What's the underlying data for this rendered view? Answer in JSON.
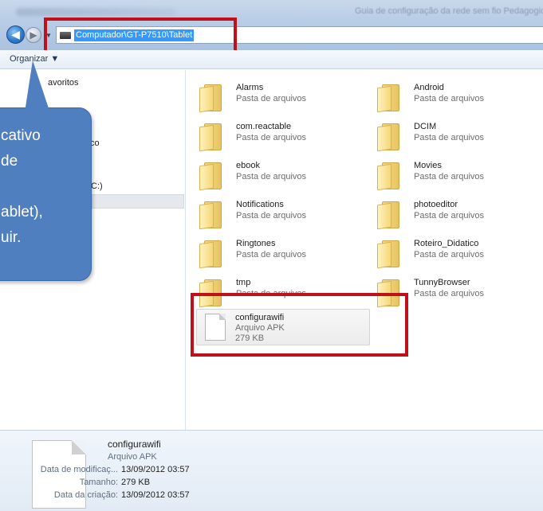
{
  "window": {
    "title": "Guia de configuração da rede sem fio Pedagogica SME"
  },
  "address": {
    "path": "Computador\\GT-P7510\\Tablet"
  },
  "toolbar": {
    "organize_label": "Organizar ▼"
  },
  "nav": {
    "items": [
      {
        "label": "avoritos"
      },
      {
        "label": "co"
      },
      {
        "label": "C:)"
      }
    ]
  },
  "callout": {
    "lines": [
      "cativo",
      "de",
      "",
      "ablet),",
      "uir."
    ]
  },
  "folders": [
    {
      "name": "Alarms",
      "type": "Pasta de arquivos"
    },
    {
      "name": "Android",
      "type": "Pasta de arquivos"
    },
    {
      "name": "com.reactable",
      "type": "Pasta de arquivos"
    },
    {
      "name": "DCIM",
      "type": "Pasta de arquivos"
    },
    {
      "name": "ebook",
      "type": "Pasta de arquivos"
    },
    {
      "name": "Movies",
      "type": "Pasta de arquivos"
    },
    {
      "name": "Notifications",
      "type": "Pasta de arquivos"
    },
    {
      "name": "photoeditor",
      "type": "Pasta de arquivos"
    },
    {
      "name": "Ringtones",
      "type": "Pasta de arquivos"
    },
    {
      "name": "Roteiro_Didatico",
      "type": "Pasta de arquivos"
    },
    {
      "name": "tmp",
      "type": "Pasta de arquivos"
    },
    {
      "name": "TunnyBrowser",
      "type": "Pasta de arquivos"
    }
  ],
  "apk_file": {
    "name": "configurawifi",
    "type": "Arquivo APK",
    "size": "279 KB"
  },
  "details": {
    "name": "configurawifi",
    "type": "Arquivo APK",
    "fields": [
      {
        "label": "Data de modificaç...",
        "value": "13/09/2012 03:57"
      },
      {
        "label": "Tamanho:",
        "value": "279 KB"
      },
      {
        "label": "Data da criação:",
        "value": "13/09/2012 03:57"
      }
    ]
  },
  "colors": {
    "highlight_box": "#c0101a",
    "callout_fill": "#4f7fbf",
    "selection": "#3399ff"
  }
}
